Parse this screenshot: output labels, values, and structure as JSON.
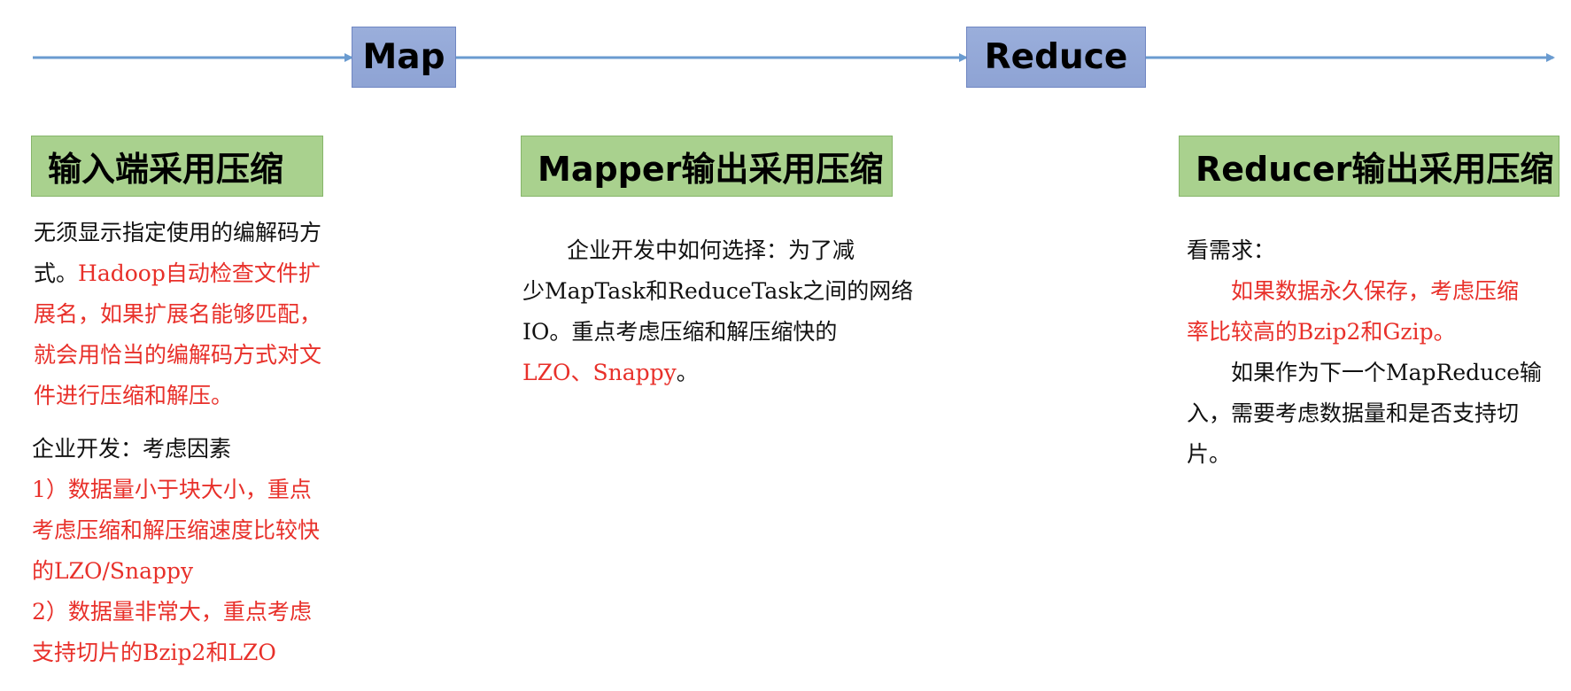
{
  "colors": {
    "stage_fill": "#9aaedb",
    "stage_border": "#6f86c2",
    "header_fill": "#a9d18e",
    "header_border": "#86b56a",
    "arrow": "#6a9bd0",
    "highlight_text": "#e8302a",
    "body_text": "#111111"
  },
  "stages": {
    "map": "Map",
    "reduce": "Reduce"
  },
  "sections": {
    "input": {
      "header": "输入端采用压缩",
      "intro": {
        "line1": "无须显示指定使用的编解码方",
        "line2_black": "式。",
        "line2_red": "Hadoop自动检查文件扩",
        "line3": "展名，如果扩展名能够匹配，",
        "line4": "就会用恰当的编解码方式对文",
        "line5": "件进行压缩和解压。"
      },
      "factors": {
        "title": "企业开发：考虑因素",
        "line1": "1）数据量小于块大小，重点",
        "line2": "考虑压缩和解压缩速度比较快",
        "line3": "的LZO/Snappy",
        "line4": "2）数据量非常大，重点考虑",
        "line5": "支持切片的Bzip2和LZO"
      }
    },
    "mapper": {
      "header": "Mapper输出采用压缩",
      "line1": "企业开发中如何选择：为了减",
      "line2": "少MapTask和ReduceTask之间的网络",
      "line3": "IO。重点考虑压缩和解压缩快的",
      "line4_red": "LZO、Snappy",
      "line4_black": "。"
    },
    "reducer": {
      "header": "Reducer输出采用压缩",
      "line1": "看需求：",
      "line2": "如果数据永久保存，考虑压缩",
      "line3_red": "率比较高的Bzip2和Gzip",
      "line3_tail": "。",
      "line4": "如果作为下一个MapReduce输",
      "line5": "入，需要考虑数据量和是否支持切",
      "line6": "片。"
    }
  }
}
